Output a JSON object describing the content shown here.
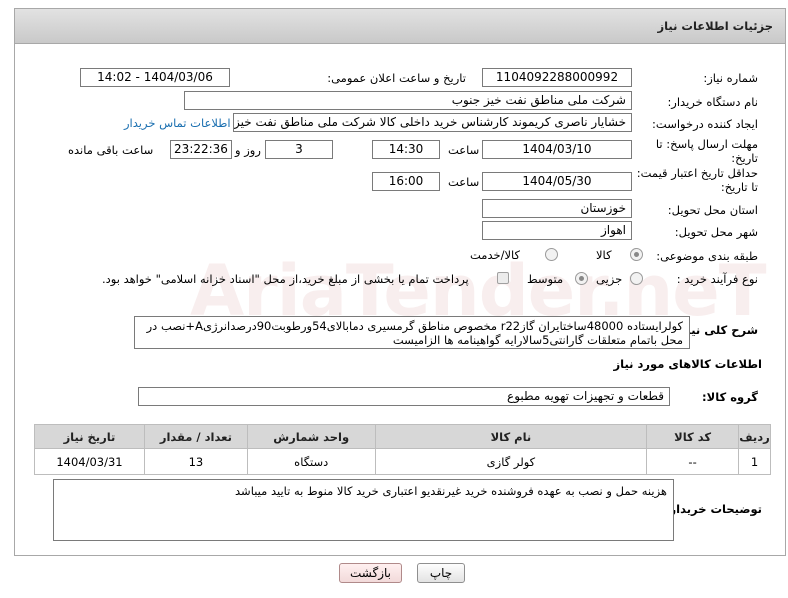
{
  "header": {
    "title": "جزئیات اطلاعات نیاز"
  },
  "watermark": "AriaTender.neT",
  "fields": {
    "need_number_label": "شماره نیاز:",
    "need_number": "1104092288000992",
    "announce_label": "تاریخ و ساعت اعلان عمومی:",
    "announce_value": "1404/03/06 - 14:02",
    "buyer_label": "نام دستگاه خریدار:",
    "buyer_value": "شرکت ملی مناطق نفت خیز جنوب",
    "creator_label": "ایجاد کننده درخواست:",
    "creator_value": "خشایار ناصری کریموند کارشناس خرید داخلی کالا  شرکت ملی مناطق نفت خیز جنوب",
    "contact_link": "اطلاعات تماس خریدار",
    "deadline_label_1": "مهلت ارسال پاسخ: تا",
    "deadline_label_2": "تاریخ:",
    "deadline_date": "1404/03/10",
    "time_label": "ساعت",
    "deadline_time": "14:30",
    "days_value": "3",
    "days_label": "روز و",
    "remaining_value": "23:22:36",
    "remaining_label": "ساعت باقی مانده",
    "price_label_1": "حداقل تاریخ اعتبار قیمت:",
    "price_label_2": "تا تاریخ:",
    "price_date": "1404/05/30",
    "price_time": "16:00",
    "province_label": "استان محل تحویل:",
    "province_value": "خوزستان",
    "city_label": "شهر محل تحویل:",
    "city_value": "اهواز",
    "category_label": "طبقه بندی موضوعی:",
    "category_options": [
      "کالا",
      "کالا/خدمت"
    ],
    "process_label": "نوع فرآیند خرید :",
    "process_options": [
      "جزیی",
      "متوسط"
    ],
    "payment_note": "پرداخت تمام یا بخشی از مبلغ خرید،از محل \"اسناد خزانه اسلامی\" خواهد بود.",
    "description_label": "شرح کلی نیاز:",
    "description_value": "کولرایستاده 48000ساختایران گازr22 مخصوص مناطق گرمسیری دمابالای54ورطوبت90درصدانرژیA+نصب در محل باتمام متعلقات گارانتی5سالارایه گواهینامه ها الزامیست",
    "goods_info_title": "اطلاعات کالاهای مورد نیاز",
    "group_label": "گروه کالا:",
    "group_value": "قطعات و تجهیزات تهویه مطبوع",
    "notes_label": "توضیحات خریدار:",
    "notes_value": "هزینه حمل و نصب به عهده فروشنده خرید غیرنقدیو اعتباری خرید کالا منوط به تایید میباشد"
  },
  "table": {
    "headers": [
      "ردیف",
      "کد کالا",
      "نام کالا",
      "واحد شمارش",
      "تعداد / مقدار",
      "تاریخ نیاز"
    ],
    "rows": [
      [
        "1",
        "--",
        "کولر گازی",
        "دستگاه",
        "13",
        "1404/03/31"
      ]
    ]
  },
  "buttons": {
    "print": "چاپ",
    "back": "بازگشت"
  }
}
